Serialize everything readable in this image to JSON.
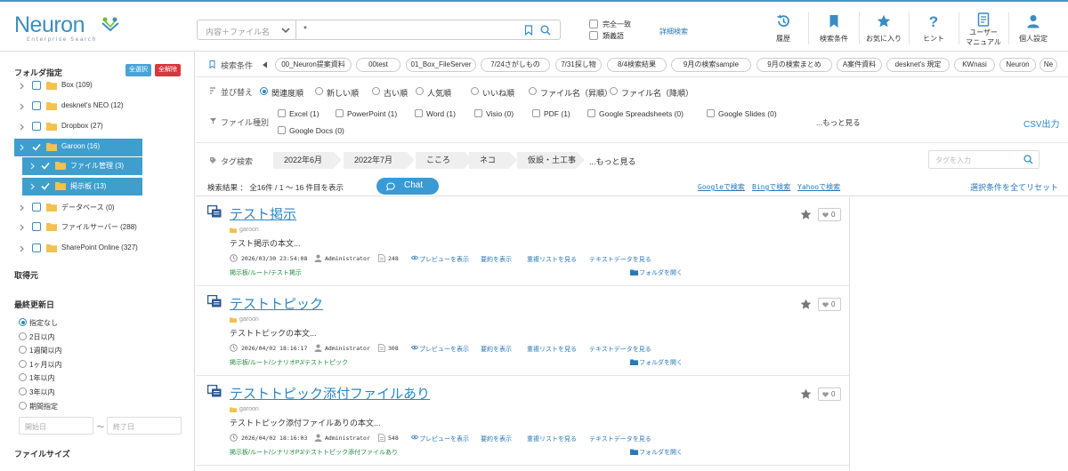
{
  "header": {
    "logo_text": "Neuron",
    "logo_subtitle": "Enterprise Search",
    "scope_label": "内容＋ファイル名",
    "search_value": "*",
    "exact_match_label": "完全一致",
    "synonym_label": "類義語",
    "advanced_search_label": "詳細検索",
    "nav": [
      {
        "label": "履歴",
        "icon": "history-icon"
      },
      {
        "label": "検索条件",
        "icon": "bookmark-icon"
      },
      {
        "label": "お気に入り",
        "icon": "star-icon"
      },
      {
        "label": "ヒント",
        "icon": "question-icon"
      },
      {
        "label": "ユーザー\nマニュアル",
        "label_line1": "ユーザー",
        "label_line2": "マニュアル",
        "icon": "manual-icon"
      },
      {
        "label": "個人設定",
        "icon": "user-icon"
      }
    ]
  },
  "sidebar": {
    "folder_title": "フォルダ指定",
    "select_all": "全選択",
    "clear_all": "全解除",
    "folders": [
      {
        "label": "Box (109)",
        "checked": false,
        "selected": false
      },
      {
        "label": "desknet's NEO (12)",
        "checked": false,
        "selected": false
      },
      {
        "label": "Dropbox (27)",
        "checked": false,
        "selected": false
      },
      {
        "label": "Garoon (16)",
        "checked": true,
        "selected": true
      },
      {
        "label": "ファイル管理 (3)",
        "checked": true,
        "selected": true
      },
      {
        "label": "掲示板 (13)",
        "checked": true,
        "selected": true
      },
      {
        "label": "データベース (0)",
        "checked": false,
        "selected": false
      },
      {
        "label": "ファイルサーバー (288)",
        "checked": false,
        "selected": false
      },
      {
        "label": "SharePoint Online (327)",
        "checked": false,
        "selected": false
      }
    ],
    "source_title": "取得元",
    "updated_title": "最終更新日",
    "date_options": [
      "指定なし",
      "2日以内",
      "1週間以内",
      "1ヶ月以内",
      "1年以内",
      "3年以内",
      "期間指定"
    ],
    "date_selected": "指定なし",
    "start_date_placeholder": "開始日",
    "date_separator": "～",
    "end_date_placeholder": "終了日",
    "filesize_title": "ファイルサイズ"
  },
  "conditions": {
    "label": "検索条件",
    "chips": [
      "00_Neuron提案資料",
      "00test",
      "01_Box_FileServer",
      "7/24さがしもの",
      "7/31探し物",
      "8/4検索結果",
      "9月の検索sample",
      "9月の検索まとめ",
      "A案件資料",
      "desknet's 規定",
      "KWnasi",
      "Neuron",
      "Ne"
    ]
  },
  "sort": {
    "label": "並び替え",
    "options": [
      "関連度順",
      "新しい順",
      "古い順",
      "人気順",
      "いいね順",
      "ファイル名（昇順）",
      "ファイル名（降順）"
    ],
    "selected": "関連度順"
  },
  "filetype": {
    "label": "ファイル種別",
    "options": [
      "Excel (1)",
      "PowerPoint (1)",
      "Word (1)",
      "Visio (0)",
      "PDF (1)",
      "Google Spreadsheets (0)",
      "Google Slides (0)",
      "Google Docs (0)"
    ],
    "more": "...もっと見る",
    "csv": "CSV出力"
  },
  "tags": {
    "label": "タグ検索",
    "chips": [
      "2022年6月",
      "2022年7月",
      "こころ",
      "ネコ",
      "仮設・土工事"
    ],
    "more": "...もっと見る",
    "input_placeholder": "タグを入力"
  },
  "result_bar": {
    "summary": "検索結果 ： 全16件 / 1 〜 16 件目を表示",
    "chat_label": "Chat",
    "google": "Googleで検索",
    "bing": "Bingで検索",
    "yahoo": "Yahooで検索",
    "reset": "選択条件を全てリセット"
  },
  "results": [
    {
      "title": "テスト掲示",
      "category": "garoon",
      "snippet": "テスト掲示の本文...",
      "datetime": "2026/03/30 23:54:08",
      "author": "Administrator",
      "size": "248",
      "preview": "プレビューを表示",
      "summary": "要約を表示",
      "related": "重複リストを見る",
      "textdata": "テキストデータを見る",
      "path": "掲示板/ルート/テスト掲示",
      "open_folder": "フォルダを開く",
      "likes": "0"
    },
    {
      "title": "テストトピック",
      "category": "garoon",
      "snippet": "テストトピックの本文...",
      "datetime": "2026/04/02 18:16:17",
      "author": "Administrator",
      "size": "308",
      "preview": "プレビューを表示",
      "summary": "要約を表示",
      "related": "重複リストを見る",
      "textdata": "テキストデータを見る",
      "path": "掲示板/ルート/シナリオPJ/テストトピック",
      "open_folder": "フォルダを開く",
      "likes": "0"
    },
    {
      "title": "テストトピック添付ファイルあり",
      "category": "garoon",
      "snippet": "テストトピック添付ファイルありの本文...",
      "datetime": "2026/04/02 18:16:03",
      "author": "Administrator",
      "size": "548",
      "preview": "プレビューを表示",
      "summary": "要約を表示",
      "related": "重複リストを見る",
      "textdata": "テキストデータを見る",
      "path": "掲示板/ルート/シナリオPJ/テストトピック添付ファイルあり",
      "open_folder": "フォルダを開く",
      "likes": "0"
    }
  ],
  "colors": {
    "accent": "#3a9bd4",
    "link": "#2e86c6",
    "danger": "#d9363e",
    "path_green": "#1e8a3e",
    "tree_selected": "#3e9fcf"
  }
}
